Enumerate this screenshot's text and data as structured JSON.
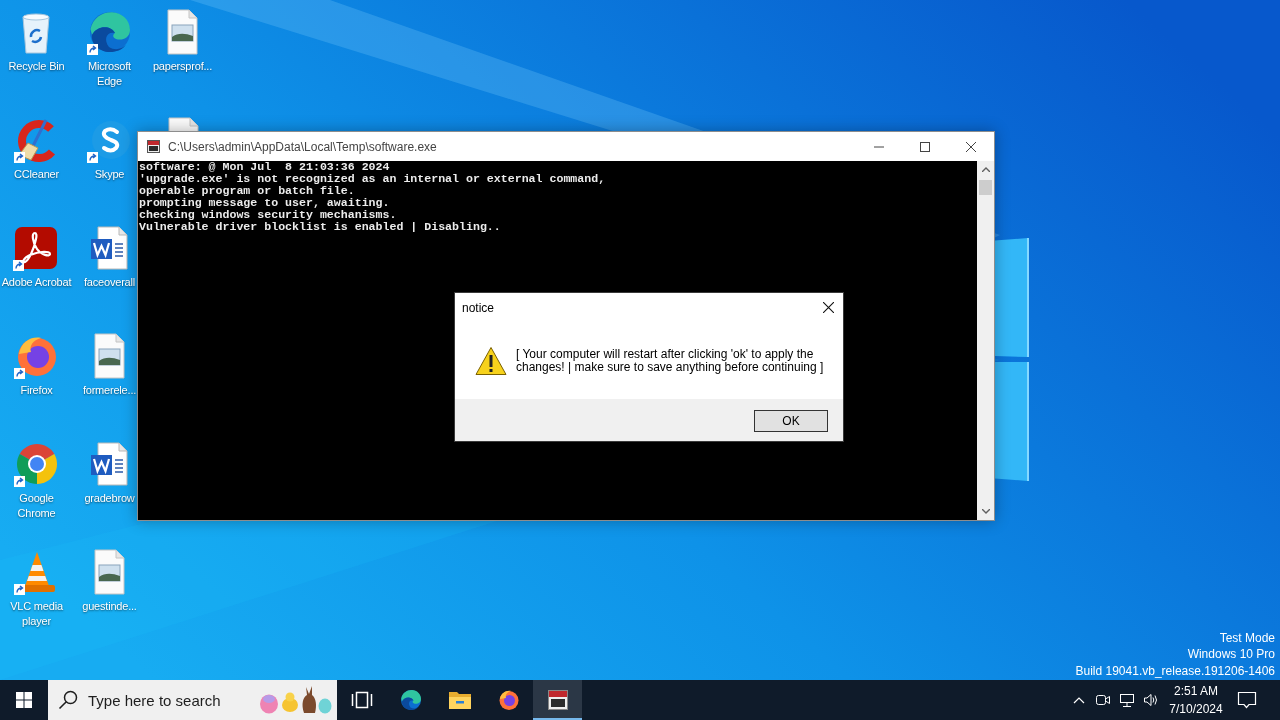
{
  "desktop": {
    "icons": [
      {
        "label": "Recycle Bin",
        "kind": "recycle-bin",
        "shortcut": false
      },
      {
        "label": "CCleaner",
        "kind": "ccleaner",
        "shortcut": true
      },
      {
        "label": "Adobe Acrobat",
        "kind": "acrobat",
        "shortcut": true
      },
      {
        "label": "Firefox",
        "kind": "firefox",
        "shortcut": true
      },
      {
        "label": "Google Chrome",
        "kind": "chrome",
        "shortcut": true
      },
      {
        "label": "VLC media player",
        "kind": "vlc",
        "shortcut": true
      },
      {
        "label": "Microsoft Edge",
        "kind": "edge",
        "shortcut": true
      },
      {
        "label": "Skype",
        "kind": "skype",
        "shortcut": true
      },
      {
        "label": "faceoverall",
        "kind": "word-doc",
        "shortcut": false
      },
      {
        "label": "formerele...",
        "kind": "image-file",
        "shortcut": false
      },
      {
        "label": "gradebrow",
        "kind": "word-doc",
        "shortcut": false
      },
      {
        "label": "guestinde...",
        "kind": "image-file",
        "shortcut": false
      },
      {
        "label": "papersprof...",
        "kind": "image-file",
        "shortcut": false
      },
      {
        "kind": "image-file",
        "shortcut": false
      }
    ],
    "system_info": [
      "Test Mode",
      "Windows 10 Pro",
      "Build 19041.vb_release.191206-1406"
    ]
  },
  "console_window": {
    "title": "C:\\Users\\admin\\AppData\\Local\\Temp\\software.exe",
    "lines": [
      "software: @ Mon Jul  8 21:03:36 2024",
      "'upgrade.exe' is not recognized as an internal or external command,",
      "operable program or batch file.",
      "prompting message to user, awaiting.",
      "checking windows security mechanisms.",
      "Vulnerable driver blocklist is enabled | Disabling.."
    ]
  },
  "dialog": {
    "title": "notice",
    "message": "[ Your computer will restart after clicking 'ok' to apply the changes! | make sure to save anything before continuing ]",
    "buttons": [
      "OK"
    ]
  },
  "taskbar": {
    "search": {
      "placeholder": "Type here to search"
    },
    "apps": [
      {
        "kind": "task-view",
        "active": false
      },
      {
        "kind": "edge",
        "active": false
      },
      {
        "kind": "explorer",
        "active": false
      },
      {
        "kind": "firefox",
        "active": false
      },
      {
        "kind": "console",
        "active": true
      }
    ],
    "tray": {
      "time": "2:51 AM",
      "date": "7/10/2024"
    }
  }
}
